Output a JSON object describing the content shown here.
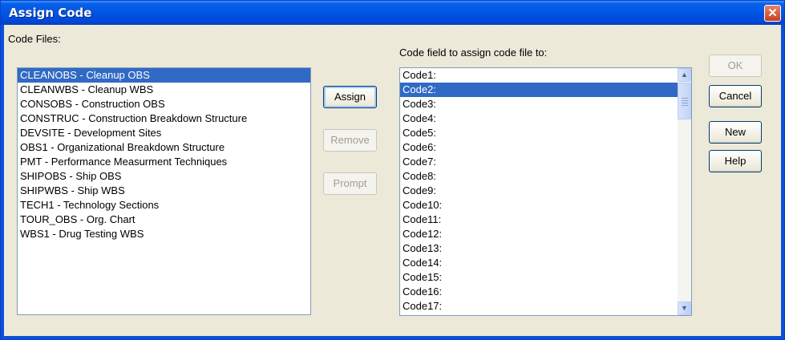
{
  "window": {
    "title": "Assign Code",
    "close_glyph": "✕"
  },
  "code_files": {
    "label": "Code Files:",
    "items": [
      "CLEANOBS - Cleanup OBS",
      "CLEANWBS - Cleanup WBS",
      "CONSOBS - Construction OBS",
      "CONSTRUC - Construction Breakdown Structure",
      "DEVSITE - Development Sites",
      "OBS1 - Organizational Breakdown Structure",
      "PMT - Performance Measurment Techniques",
      "SHIPOBS - Ship OBS",
      "SHIPWBS - Ship WBS",
      "TECH1 - Technology Sections",
      "TOUR_OBS - Org. Chart",
      "WBS1 - Drug Testing WBS"
    ],
    "selected_index": 0
  },
  "middle_buttons": {
    "assign": "Assign",
    "remove": "Remove",
    "prompt": "Prompt"
  },
  "code_fields": {
    "label": "Code field to assign code file to:",
    "items": [
      "Code1:",
      "Code2:",
      "Code3:",
      "Code4:",
      "Code5:",
      "Code6:",
      "Code7:",
      "Code8:",
      "Code9:",
      "Code10:",
      "Code11:",
      "Code12:",
      "Code13:",
      "Code14:",
      "Code15:",
      "Code16:",
      "Code17:"
    ],
    "selected_index": 1
  },
  "right_buttons": {
    "ok": "OK",
    "cancel": "Cancel",
    "new": "New",
    "help": "Help"
  },
  "icons": {
    "scroll_up": "▲",
    "scroll_down": "▼"
  },
  "colors": {
    "title_bar": "#0055e5",
    "selection": "#316ac5",
    "dialog_bg": "#ece9d8",
    "close_button": "#c9401b"
  }
}
